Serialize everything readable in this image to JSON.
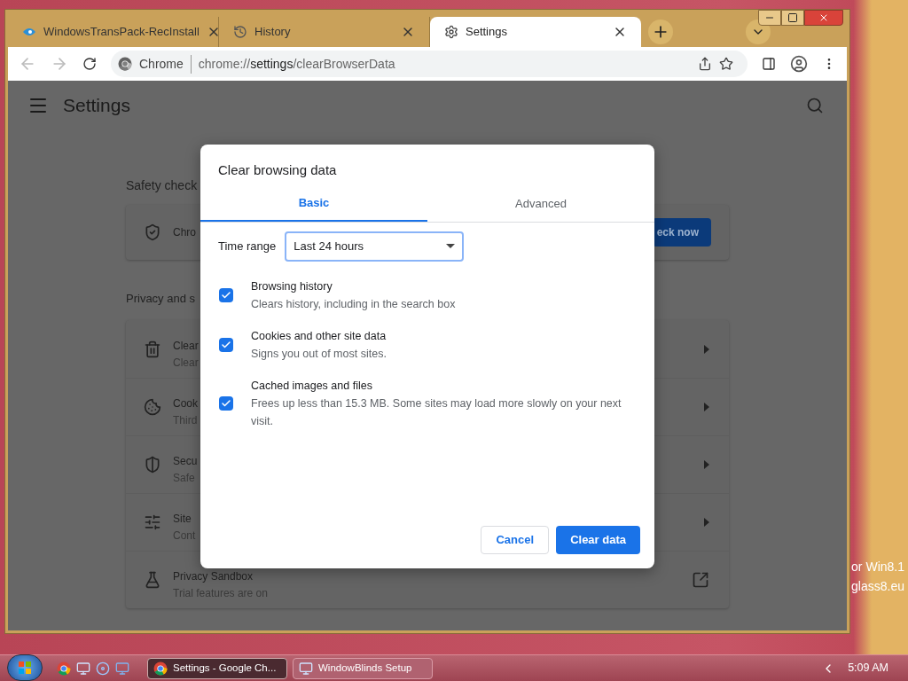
{
  "desktop": {
    "text_lines": [
      "or Win8.1",
      "glass8.eu"
    ]
  },
  "browser": {
    "tabs": [
      {
        "title": "WindowsTransPack-RecInstall",
        "selected": false
      },
      {
        "title": "History",
        "selected": false
      },
      {
        "title": "Settings",
        "selected": true
      }
    ],
    "omnibox": {
      "chip": "Chrome",
      "url_prefix": "chrome://",
      "url_host": "settings",
      "url_path": "/clearBrowserData"
    }
  },
  "page": {
    "title": "Settings",
    "safety_check": {
      "heading": "Safety check",
      "row_text": "Chro",
      "button": "eck now"
    },
    "privacy": {
      "heading": "Privacy and s",
      "rows": [
        {
          "title": "Clear",
          "subtitle": "Clear",
          "kind": "arrow"
        },
        {
          "title": "Cook",
          "subtitle": "Third",
          "kind": "arrow"
        },
        {
          "title": "Secu",
          "subtitle": "Safe",
          "kind": "arrow"
        },
        {
          "title": "Site",
          "subtitle": "Cont",
          "kind": "arrow"
        },
        {
          "title": "Privacy Sandbox",
          "subtitle": "Trial features are on",
          "kind": "external"
        }
      ]
    }
  },
  "dialog": {
    "title": "Clear browsing data",
    "tabs": [
      {
        "label": "Basic",
        "selected": true
      },
      {
        "label": "Advanced",
        "selected": false
      }
    ],
    "time_range": {
      "label": "Time range",
      "value": "Last 24 hours"
    },
    "options": [
      {
        "title": "Browsing history",
        "description": "Clears history, including in the search box",
        "checked": true
      },
      {
        "title": "Cookies and other site data",
        "description": "Signs you out of most sites.",
        "checked": true
      },
      {
        "title": "Cached images and files",
        "description": "Frees up less than 15.3 MB. Some sites may load more slowly on your next visit.",
        "checked": true
      }
    ],
    "buttons": {
      "cancel": "Cancel",
      "confirm": "Clear data"
    }
  },
  "taskbar": {
    "tasks": [
      {
        "label": "Settings - Google Ch...",
        "selected": true
      },
      {
        "label": "WindowBlinds Setup",
        "selected": false
      }
    ],
    "clock": "5:09 AM"
  }
}
